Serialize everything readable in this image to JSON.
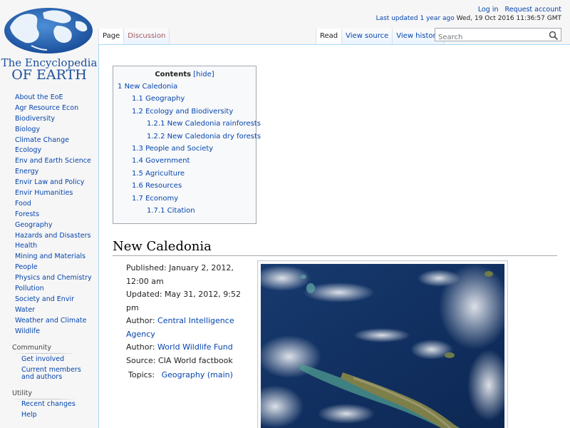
{
  "logo": {
    "line1": "The Encyclopedia",
    "line2": "OF EARTH"
  },
  "sidebar": {
    "nav": [
      "About the EoE",
      "Agr Resource Econ",
      "Biodiversity",
      "Biology",
      "Climate Change",
      "Ecology",
      "Env and Earth Science",
      "Energy",
      "Envir Law and Policy",
      "Envir Humanities",
      "Food",
      "Forests",
      "Geography",
      "Hazards and Disasters",
      "Health",
      "Mining and Materials",
      "People",
      "Physics and Chemistry",
      "Pollution",
      "Society and Envir",
      "Water",
      "Weather and Climate",
      "Wildlife"
    ],
    "community": {
      "heading": "Community",
      "items": [
        "Get involved",
        "Current members and authors"
      ]
    },
    "utility": {
      "heading": "Utility",
      "items": [
        "Recent changes",
        "Help"
      ]
    }
  },
  "personal": {
    "login": "Log in",
    "request": "Request account",
    "updated_label": "Last updated 1 year ago",
    "updated_date": "Wed, 19 Oct 2016 11:36:57 GMT"
  },
  "tabs": {
    "page": "Page",
    "discussion": "Discussion",
    "read": "Read",
    "view_source": "View source",
    "view_history": "View history"
  },
  "search": {
    "placeholder": "Search"
  },
  "toc": {
    "title": "Contents",
    "hide": "[hide]",
    "items": [
      {
        "num": "1",
        "text": "New Caledonia",
        "level": 1
      },
      {
        "num": "1.1",
        "text": "Geography",
        "level": 2
      },
      {
        "num": "1.2",
        "text": "Ecology and Biodiversity",
        "level": 2
      },
      {
        "num": "1.2.1",
        "text": "New Caledonia rainforests",
        "level": 3
      },
      {
        "num": "1.2.2",
        "text": "New Caledonia dry forests",
        "level": 3
      },
      {
        "num": "1.3",
        "text": "People and Society",
        "level": 2
      },
      {
        "num": "1.4",
        "text": "Government",
        "level": 2
      },
      {
        "num": "1.5",
        "text": "Agriculture",
        "level": 2
      },
      {
        "num": "1.6",
        "text": "Resources",
        "level": 2
      },
      {
        "num": "1.7",
        "text": "Economy",
        "level": 2
      },
      {
        "num": "1.7.1",
        "text": "Citation",
        "level": 3
      }
    ]
  },
  "article": {
    "heading": "New Caledonia",
    "published_label": "Published:",
    "published": "January 2, 2012, 12:00 am",
    "updated_label": "Updated:",
    "updated": "May 31, 2012, 9:52 pm",
    "author_label": "Author:",
    "author1": "Central Intelligence Agency",
    "author2": "World Wildlife Fund",
    "source_label": "Source:",
    "source": "CIA World factbook",
    "topics_label": "Topics:",
    "topic": "Geography (main)"
  }
}
